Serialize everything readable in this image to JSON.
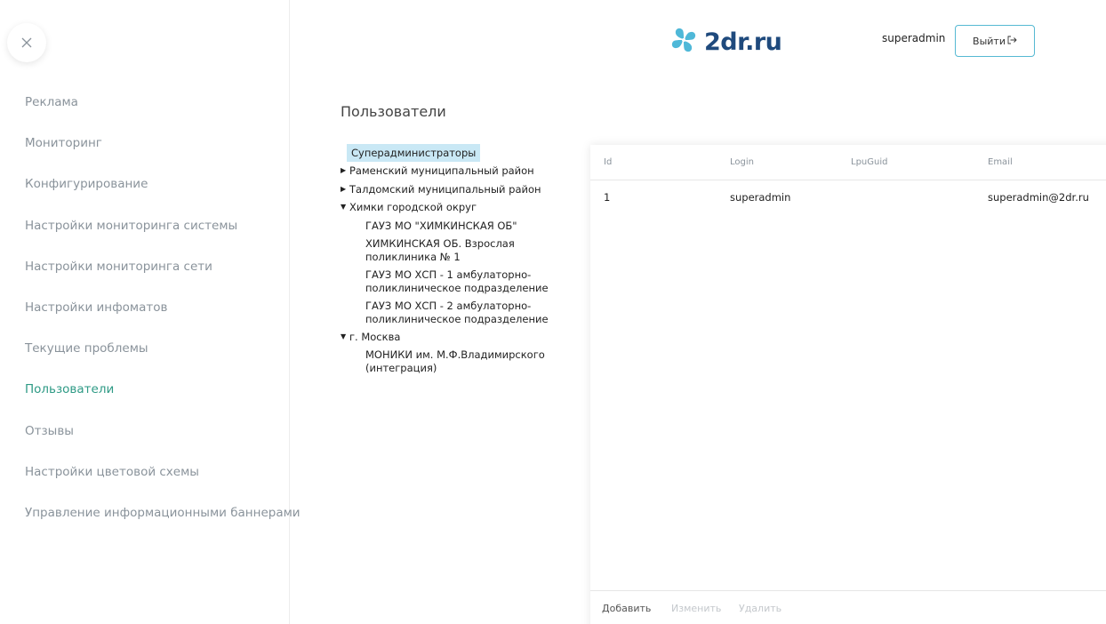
{
  "header": {
    "logo_text": "2dr.ru",
    "username": "superadmin",
    "logout_label": "Выйти"
  },
  "sidebar": {
    "items": [
      {
        "label": "Реклама"
      },
      {
        "label": "Мониторинг"
      },
      {
        "label": "Конфигурирование"
      },
      {
        "label": "Настройки мониторинга системы"
      },
      {
        "label": "Настройки мониторинга сети"
      },
      {
        "label": "Настройки инфоматов"
      },
      {
        "label": "Текущие проблемы"
      },
      {
        "label": "Пользователи",
        "active": true
      },
      {
        "label": "Отзывы"
      },
      {
        "label": "Настройки цветовой схемы"
      },
      {
        "label": "Управление информационными баннерами"
      }
    ]
  },
  "page": {
    "title": "Пользователи"
  },
  "tree": {
    "selected": "Суперадминистраторы",
    "nodes": [
      {
        "label": "Раменский муниципальный район",
        "expanded": false
      },
      {
        "label": "Талдомский муниципальный район",
        "expanded": false
      },
      {
        "label": "Химки городской округ",
        "expanded": true,
        "children": [
          "ГАУЗ МО \"ХИМКИНСКАЯ ОБ\"",
          "ХИМКИНСКАЯ ОБ. Взрослая поликлиника № 1",
          "ГАУЗ МО ХСП - 1 амбулаторно-поликлиническое подразделение",
          "ГАУЗ МО ХСП - 2 амбулаторно-поликлиническое подразделение"
        ]
      },
      {
        "label": "г. Москва",
        "expanded": true,
        "children": [
          "МОНИКИ им. М.Ф.Владимирского (интеграция)"
        ]
      }
    ]
  },
  "table": {
    "columns": [
      "Id",
      "Login",
      "LpuGuid",
      "Email"
    ],
    "rows": [
      {
        "id": "1",
        "login": "superadmin",
        "lpuguid": "",
        "email": "superadmin@2dr.ru"
      }
    ]
  },
  "footer": {
    "add_label": "Добавить",
    "edit_label": "Изменить",
    "delete_label": "Удалить"
  },
  "colors": {
    "accent": "#2e9a85",
    "logo_blue": "#1f4a7d",
    "logo_clover": "#4fb8d8",
    "selected_bg": "#c9e8f5",
    "button_border": "#56b9d3"
  },
  "icons": {
    "close": "close-icon",
    "logo": "clover-logo-icon",
    "logout": "logout-icon",
    "expand": "triangle-right-icon",
    "collapse": "triangle-down-icon"
  }
}
